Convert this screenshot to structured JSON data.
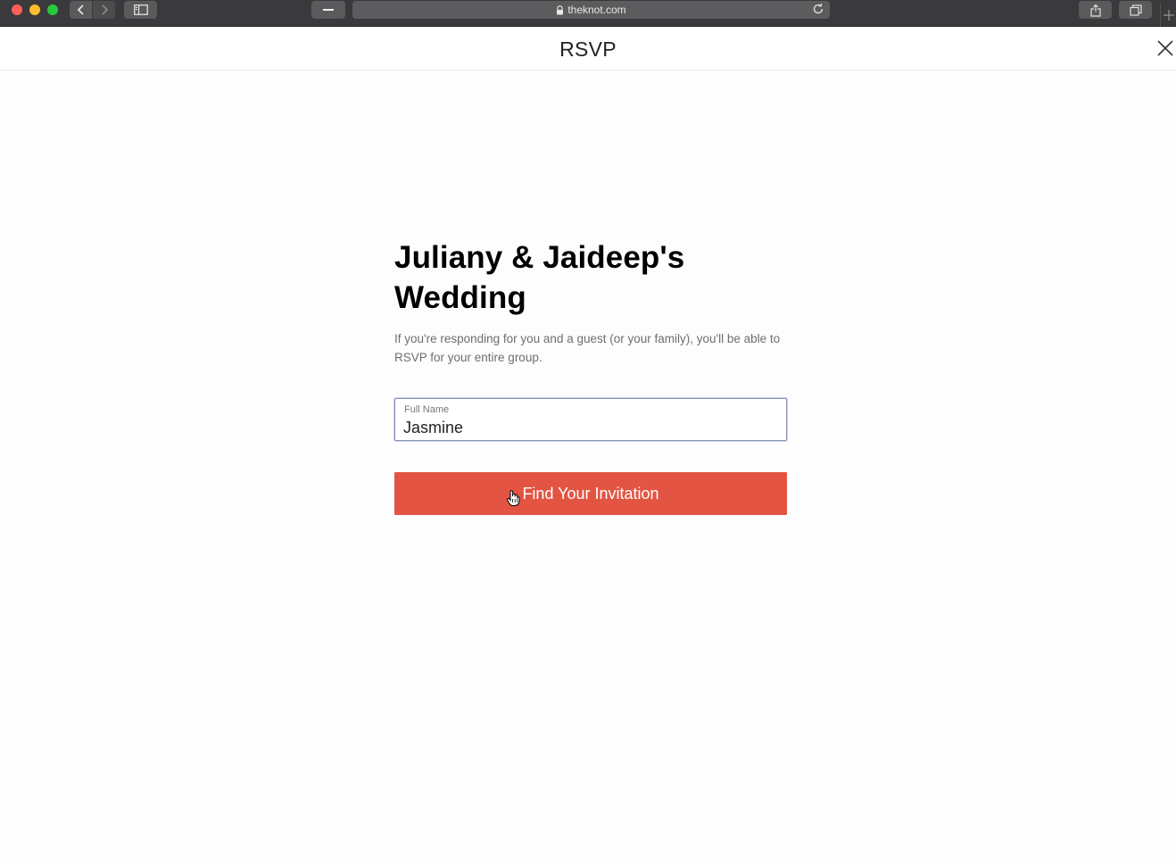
{
  "browser": {
    "url": "theknot.com"
  },
  "header": {
    "title": "RSVP"
  },
  "main": {
    "title_line1": "Juliany & Jaideep's",
    "title_line2": "Wedding",
    "subtitle_line1": "If you're responding for you and a guest (or your family), you'll be able to",
    "subtitle_line2": "RSVP for your entire group."
  },
  "form": {
    "name_label": "Full Name",
    "name_value": "Jasmine",
    "submit_label": "Find Your Invitation"
  },
  "colors": {
    "button": "#e35443",
    "chrome": "#3a3a3c"
  }
}
